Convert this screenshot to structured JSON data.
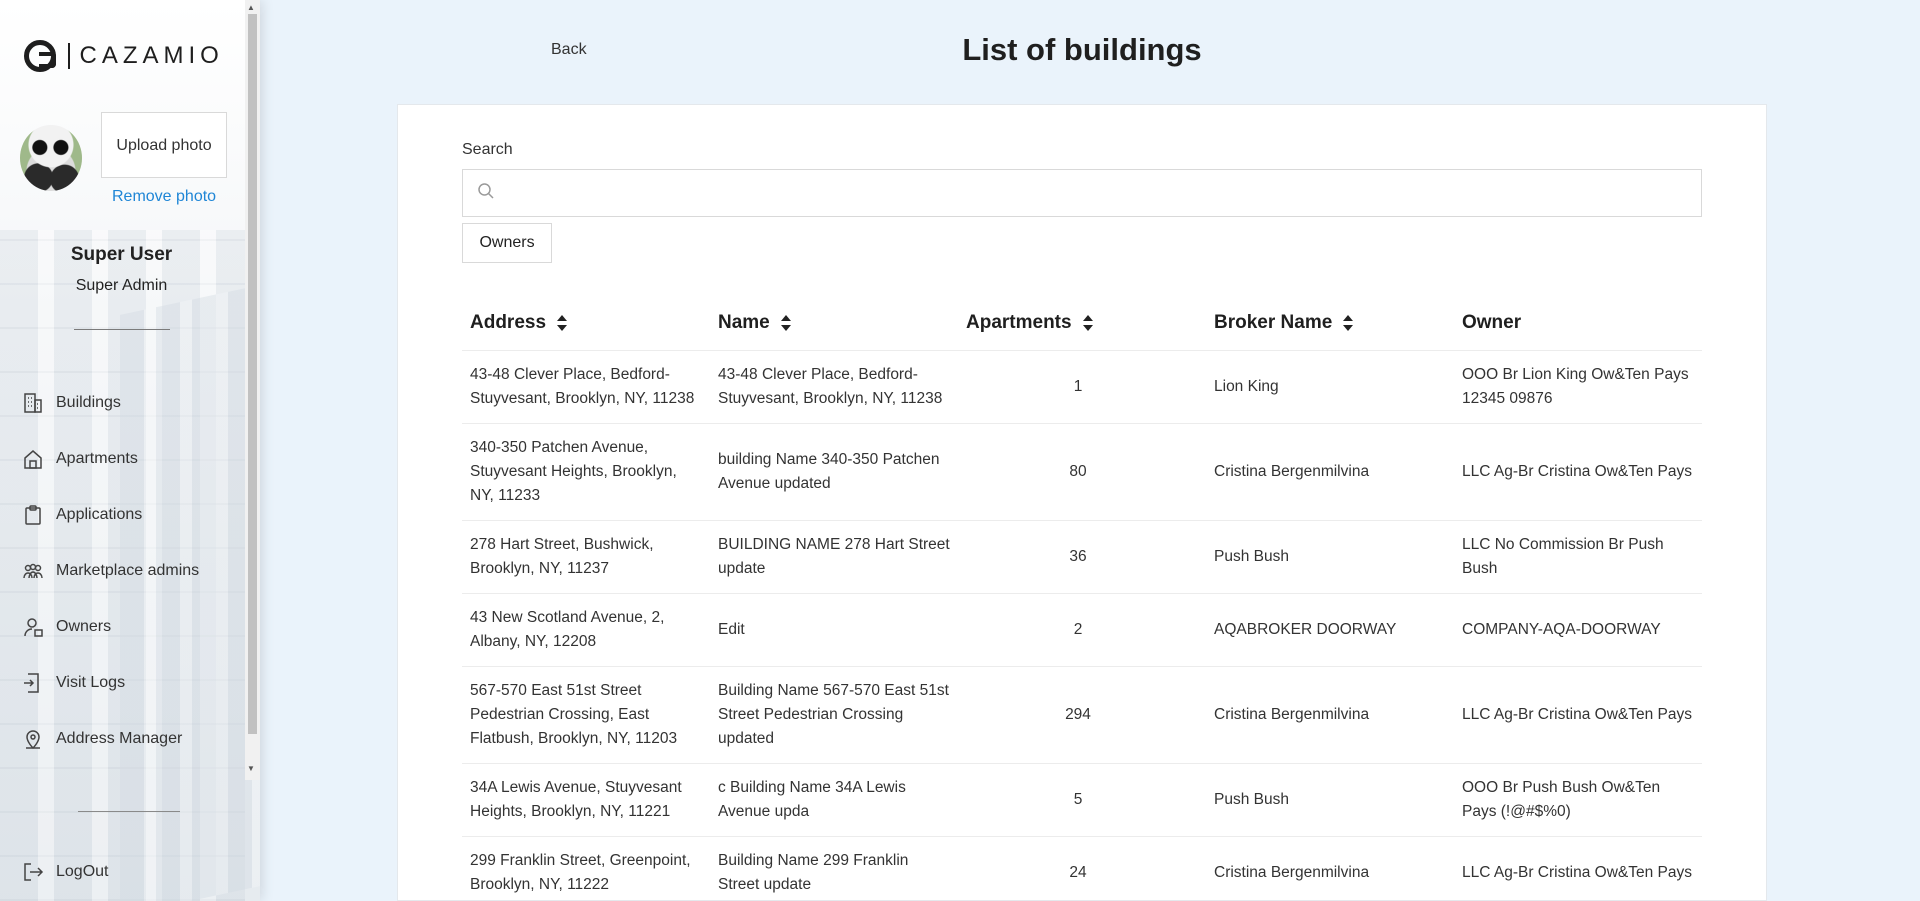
{
  "brand": {
    "name": "CAZAMIO"
  },
  "profile": {
    "upload_label": "Upload photo",
    "remove_label": "Remove photo",
    "user_name": "Super User",
    "user_role": "Super Admin"
  },
  "nav": {
    "items": [
      {
        "label": "Buildings",
        "icon": "buildings-icon"
      },
      {
        "label": "Apartments",
        "icon": "home-icon"
      },
      {
        "label": "Applications",
        "icon": "clipboard-icon"
      },
      {
        "label": "Marketplace admins",
        "icon": "users-group-icon"
      },
      {
        "label": "Owners",
        "icon": "owner-icon"
      },
      {
        "label": "Visit Logs",
        "icon": "visit-logs-icon"
      },
      {
        "label": "Address Manager",
        "icon": "location-icon"
      }
    ],
    "logout_label": "LogOut"
  },
  "header": {
    "back_label": "Back",
    "title": "List of buildings"
  },
  "search": {
    "label": "Search",
    "placeholder": "",
    "value": ""
  },
  "filters": {
    "owners_label": "Owners"
  },
  "table": {
    "columns": [
      "Address",
      "Name",
      "Apartments",
      "Broker Name",
      "Owner"
    ],
    "rows": [
      {
        "address": "43-48 Clever Place, Bedford-Stuyvesant, Brooklyn, NY, 11238",
        "name": "43-48 Clever Place, Bedford-Stuyvesant, Brooklyn, NY, 11238",
        "apartments": "1",
        "broker": "Lion King",
        "owner": "OOO Br Lion King Ow&Ten Pays 12345 09876"
      },
      {
        "address": "340-350 Patchen Avenue, Stuyvesant Heights, Brooklyn, NY, 11233",
        "name": "building Name 340-350 Patchen Avenue updated",
        "apartments": "80",
        "broker": "Cristina Bergenmilvina",
        "owner": "LLC Ag-Br Cristina Ow&Ten Pays"
      },
      {
        "address": "278 Hart Street, Bushwick, Brooklyn, NY, 11237",
        "name": "BUILDING NAME 278 Hart Street update",
        "apartments": "36",
        "broker": "Push Bush",
        "owner": "LLC No Commission Br Push Bush"
      },
      {
        "address": "43 New Scotland Avenue, 2, Albany, NY, 12208",
        "name": "Edit",
        "apartments": "2",
        "broker": "AQABROKER DOORWAY",
        "owner": "COMPANY-AQA-DOORWAY"
      },
      {
        "address": "567-570 East 51st Street Pedestrian Crossing, East Flatbush, Brooklyn, NY, 11203",
        "name": "Building Name 567-570 East 51st Street Pedestrian Crossing updated",
        "apartments": "294",
        "broker": "Cristina Bergenmilvina",
        "owner": "LLC Ag-Br Cristina Ow&Ten Pays"
      },
      {
        "address": "34A Lewis Avenue, Stuyvesant Heights, Brooklyn, NY, 11221",
        "name": "c Building Name 34A Lewis Avenue upda",
        "apartments": "5",
        "broker": "Push Bush",
        "owner": "OOO Br Push Bush Ow&Ten Pays (!@#$%0)"
      },
      {
        "address": "299 Franklin Street, Greenpoint, Brooklyn, NY, 11222",
        "name": "Building Name 299 Franklin Street update",
        "apartments": "24",
        "broker": "Cristina Bergenmilvina",
        "owner": "LLC Ag-Br Cristina Ow&Ten Pays"
      }
    ]
  },
  "colors": {
    "accent_link": "#1f86d6",
    "page_bg": "#eaf3fb",
    "card_bg": "#ffffff"
  }
}
